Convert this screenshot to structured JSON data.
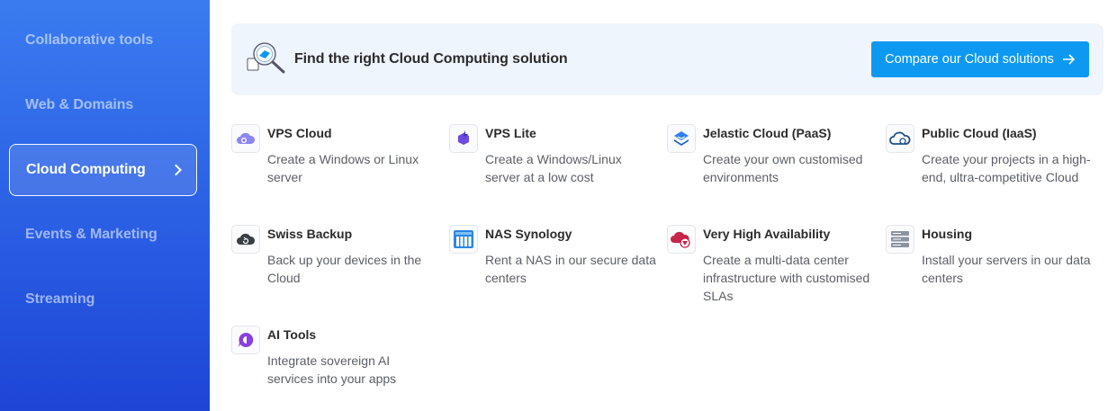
{
  "sidebar": {
    "items": [
      {
        "label": "Collaborative tools"
      },
      {
        "label": "Web & Domains"
      },
      {
        "label": "Cloud Computing"
      },
      {
        "label": "Events & Marketing"
      },
      {
        "label": "Streaming"
      }
    ],
    "active_index": 2,
    "active_icon": "chevron-right-icon"
  },
  "banner": {
    "icon": "magnifier-cloud-icon",
    "title": "Find the right Cloud Computing solution",
    "button_label": "Compare our Cloud solutions",
    "button_icon": "arrow-right-icon"
  },
  "products": [
    {
      "title": "VPS Cloud",
      "desc": "Create a Windows or Linux server",
      "icon": "vps-cloud-icon"
    },
    {
      "title": "VPS Lite",
      "desc": "Create a Windows/Linux server at a low cost",
      "icon": "vps-lite-icon"
    },
    {
      "title": "Jelastic Cloud (PaaS)",
      "desc": "Create your own customised environments",
      "icon": "jelastic-icon"
    },
    {
      "title": "Public Cloud (IaaS)",
      "desc": "Create your projects in a high-end, ultra-competitive Cloud",
      "icon": "public-cloud-icon"
    },
    {
      "title": "Swiss Backup",
      "desc": "Back up your devices in the Cloud",
      "icon": "backup-icon"
    },
    {
      "title": "NAS Synology",
      "desc": "Rent a NAS in our secure data centers",
      "icon": "nas-icon"
    },
    {
      "title": "Very High Availability",
      "desc": "Create a multi-data center infrastructure with customised SLAs",
      "icon": "high-availability-icon"
    },
    {
      "title": "Housing",
      "desc": "Install your servers in our data centers",
      "icon": "server-rack-icon"
    },
    {
      "title": "AI Tools",
      "desc": "Integrate sovereign AI services into your apps",
      "icon": "ai-tools-icon"
    }
  ],
  "colors": {
    "accent": "#0d99f2",
    "sidebar_top": "#3a7cf0",
    "sidebar_bottom": "#1d45d6",
    "banner_bg": "#eff5fd"
  }
}
